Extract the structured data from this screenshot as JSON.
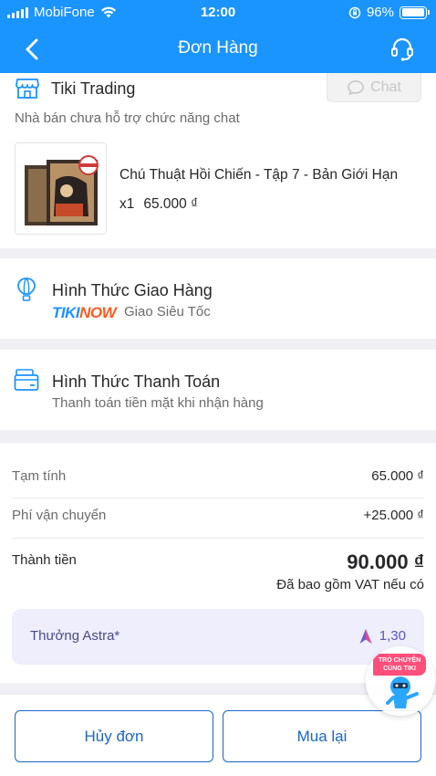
{
  "status_bar": {
    "carrier": "MobiFone",
    "time": "12:00",
    "battery": "96%",
    "battery_level": 0.96
  },
  "nav": {
    "title": "Đơn Hàng"
  },
  "shop": {
    "name": "Tiki Trading",
    "chat_label": "Chat",
    "no_chat_note": "Nhà bán chưa hỗ trợ chức năng chat",
    "product": {
      "name": "Chú Thuật Hồi Chiến - Tập 7 - Bản Giới Hạn",
      "qty": "x1",
      "price": "65.000 ₫"
    }
  },
  "delivery": {
    "heading": "Hình Thức Giao Hàng",
    "brand_part1": "TIKI",
    "brand_part2": "NOW",
    "method": "Giao Siêu Tốc"
  },
  "payment": {
    "heading": "Hình Thức Thanh Toán",
    "method": "Thanh toán tiền mặt khi nhận hàng"
  },
  "summary": {
    "subtotal_label": "Tạm tính",
    "subtotal_value": "65.000 ₫",
    "shipping_label": "Phí vận chuyển",
    "shipping_value": "+25.000 ₫",
    "total_label": "Thành tiền",
    "total_value": "90.000 ₫",
    "vat_note": "Đã bao gồm VAT nếu có",
    "astra_label": "Thưởng Astra*",
    "astra_value": "1,30"
  },
  "actions": {
    "cancel_label": "Hủy đơn",
    "rebuy_label": "Mua lại"
  },
  "chat_bubble": {
    "label": "TRÒ CHUYỆN CÙNG TIKI"
  },
  "colors": {
    "primary": "#1a94ff",
    "button_border": "#1b66c9",
    "astra_bg": "#efeefc",
    "tikinow_orange": "#ff5a1f"
  }
}
